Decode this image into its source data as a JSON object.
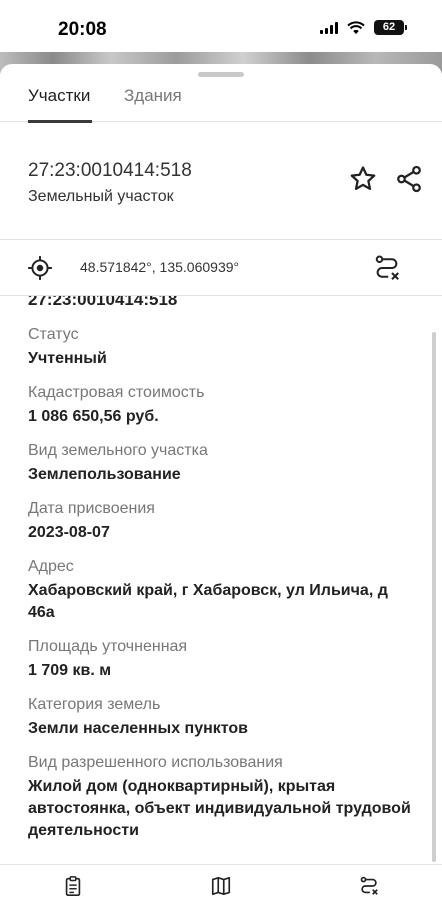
{
  "status_bar": {
    "time": "20:08",
    "battery": "62"
  },
  "tabs": [
    {
      "label": "Участки",
      "active": true
    },
    {
      "label": "Здания",
      "active": false
    }
  ],
  "header": {
    "cadastral_number": "27:23:0010414:518",
    "object_type": "Земельный участок"
  },
  "coords": {
    "text": "48.571842°, 135.060939°"
  },
  "details": {
    "top_value": "27:23:0010414:518",
    "fields": [
      {
        "label": "Статус",
        "value": "Учтенный"
      },
      {
        "label": "Кадастровая стоимость",
        "value": "1 086 650,56 руб."
      },
      {
        "label": "Вид земельного участка",
        "value": "Землепользование"
      },
      {
        "label": "Дата присвоения",
        "value": "2023-08-07"
      },
      {
        "label": "Адрес",
        "value": "Хабаровский край, г Хабаровск, ул Ильича, д 46а"
      },
      {
        "label": "Площадь уточненная",
        "value": "1 709 кв. м"
      },
      {
        "label": "Категория земель",
        "value": "Земли населенных пунктов"
      },
      {
        "label": "Вид разрешенного использования",
        "value": "Жилой дом (одноквартирный), крытая автостоянка, объект индивидуальной трудовой деятельности"
      }
    ]
  },
  "icons": {
    "star": "star-icon",
    "share": "share-icon",
    "locate": "crosshair-icon",
    "route": "route-icon",
    "nav_list": "clipboard-icon",
    "nav_map": "map-icon",
    "nav_routes": "route-icon"
  }
}
